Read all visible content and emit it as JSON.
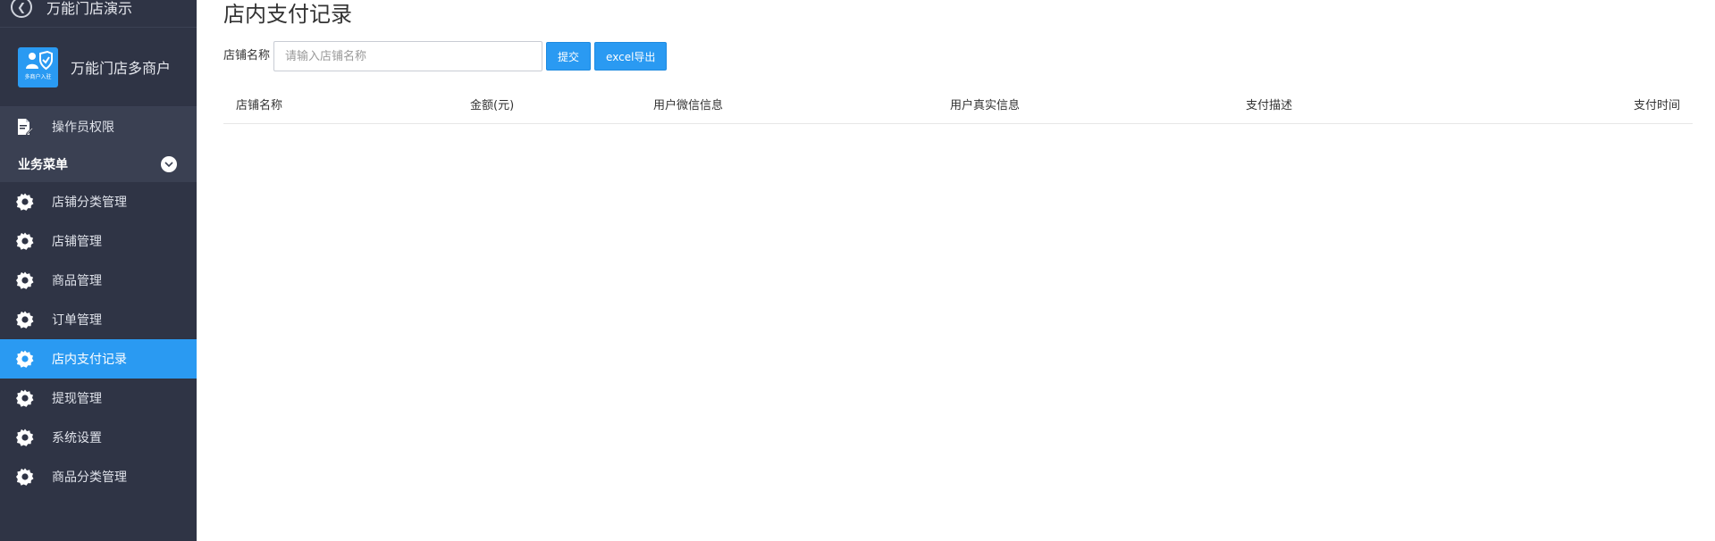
{
  "topbar": {
    "title": "万能门店演示"
  },
  "brand": {
    "name": "万能门店多商户",
    "logo_text": "多商户入驻"
  },
  "sidebar": {
    "top_item": {
      "label": "操作员权限",
      "icon": "document-edit-icon"
    },
    "section": {
      "label": "业务菜单"
    },
    "items": [
      {
        "label": "店铺分类管理",
        "icon": "gear-icon"
      },
      {
        "label": "店铺管理",
        "icon": "gear-icon"
      },
      {
        "label": "商品管理",
        "icon": "gear-icon"
      },
      {
        "label": "订单管理",
        "icon": "gear-icon"
      },
      {
        "label": "店内支付记录",
        "icon": "gear-icon",
        "active": true
      },
      {
        "label": "提现管理",
        "icon": "gear-icon"
      },
      {
        "label": "系统设置",
        "icon": "gear-icon"
      },
      {
        "label": "商品分类管理",
        "icon": "gear-icon"
      }
    ]
  },
  "main": {
    "title": "店内支付记录",
    "filter": {
      "label": "店铺名称",
      "placeholder": "请输入店铺名称",
      "value": "",
      "submit_label": "提交",
      "export_label": "excel导出"
    },
    "table": {
      "columns": [
        "店铺名称",
        "金额(元)",
        "用户微信信息",
        "用户真实信息",
        "支付描述",
        "支付时间"
      ],
      "rows": []
    }
  },
  "colors": {
    "sidebar_bg": "#2f3445",
    "accent": "#2a9af2",
    "section_bg": "#3a4052"
  }
}
